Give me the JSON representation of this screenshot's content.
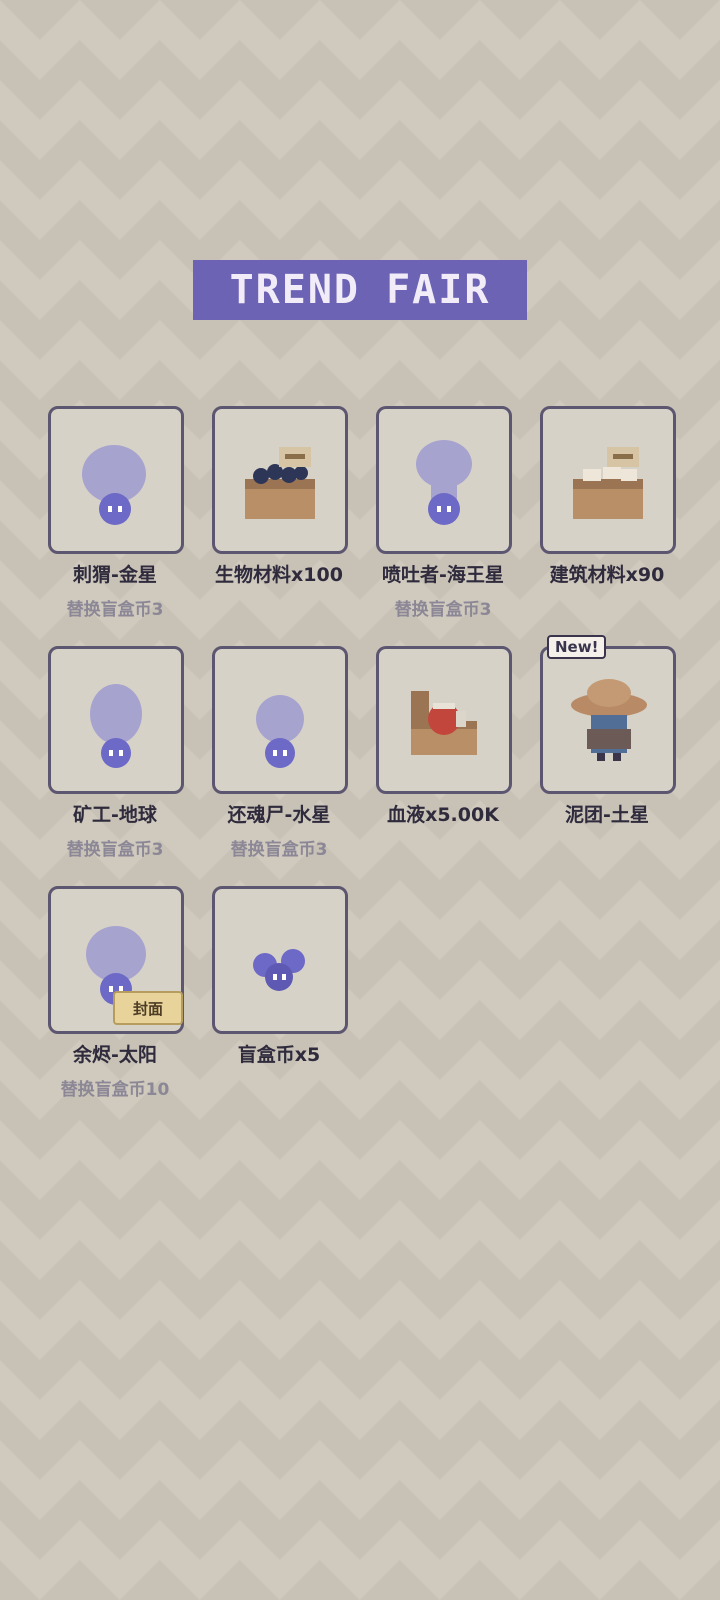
{
  "header": {
    "title": "TREND FAIR"
  },
  "items": [
    {
      "label": "刺猬-金星",
      "sub": "替换盲盒币3",
      "icon": "ghost-blob-icon"
    },
    {
      "label": "生物材料x100",
      "sub": "",
      "icon": "box-black-materials-icon"
    },
    {
      "label": "喷吐者-海王星",
      "sub": "替换盲盒币3",
      "icon": "ghost-blob-icon"
    },
    {
      "label": "建筑材料x90",
      "sub": "",
      "icon": "box-white-materials-icon"
    },
    {
      "label": "矿工-地球",
      "sub": "替换盲盒币3",
      "icon": "ghost-blob-icon"
    },
    {
      "label": "还魂尸-水星",
      "sub": "替换盲盒币3",
      "icon": "ghost-blob-icon"
    },
    {
      "label": "血液x5.00K",
      "sub": "",
      "icon": "blood-box-icon"
    },
    {
      "label": "泥团-土星",
      "sub": "",
      "icon": "straw-hat-character-icon",
      "badge": "New!"
    },
    {
      "label": "余烬-太阳",
      "sub": "替换盲盒币10",
      "icon": "ghost-blob-icon",
      "tag": "封面"
    },
    {
      "label": "盲盒币x5",
      "sub": "",
      "icon": "blind-box-coins-icon"
    }
  ],
  "colors": {
    "title_bg": "#6c63b5",
    "card_border": "#5d5670",
    "blob": "#a7a3cf",
    "coin": "#6d69c6"
  }
}
